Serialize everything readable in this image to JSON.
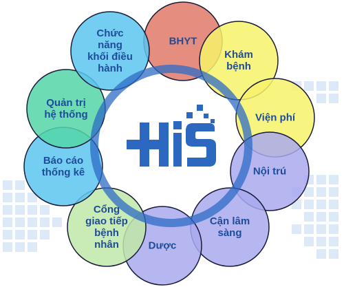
{
  "diagram": {
    "center_logo": "HIS",
    "nodes": [
      {
        "id": "bhyt",
        "label": "BHYT",
        "color": "#e07a6a"
      },
      {
        "id": "kham-benh",
        "label": "Khám\nbệnh",
        "color": "#f7f26a"
      },
      {
        "id": "vien-phi",
        "label": "Viện phí",
        "color": "#f7f26a"
      },
      {
        "id": "noi-tru",
        "label": "Nội trú",
        "color": "#a9a9ee"
      },
      {
        "id": "can-lam-sang",
        "label": "Cận lâm\nsàng",
        "color": "#a9a9ee"
      },
      {
        "id": "duoc",
        "label": "Dược",
        "color": "#a9a9ee"
      },
      {
        "id": "cong-giao-tiep",
        "label": "Cổng\ngiao tiếp\nbệnh\nnhân",
        "color": "#bfe8a8"
      },
      {
        "id": "bao-cao",
        "label": "Báo cáo\nthống kê",
        "color": "#5cc6f0"
      },
      {
        "id": "quan-tri",
        "label": "Quản trị\nhệ thống",
        "color": "#54d6a8"
      },
      {
        "id": "chuc-nang",
        "label": "Chức\nnăng\nkhối điều\nhành",
        "color": "#5cc6f0"
      }
    ],
    "ring_color": "#2d6bc4",
    "logo_color": "#2c67c0"
  }
}
